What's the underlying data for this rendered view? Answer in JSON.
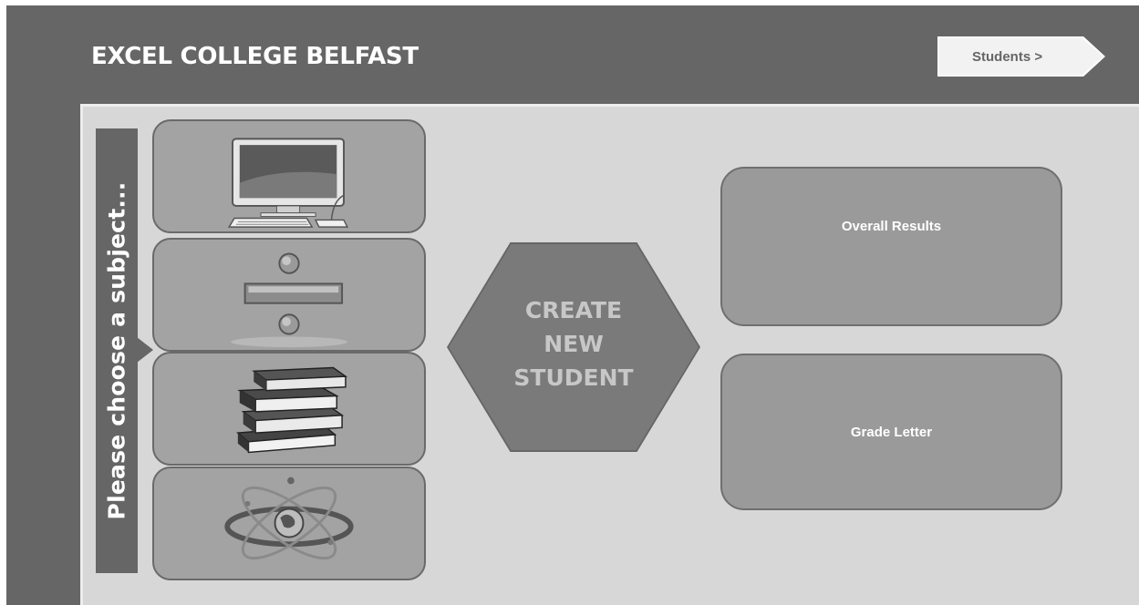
{
  "header": {
    "title": "EXCEL COLLEGE BELFAST",
    "students_button": "Students >"
  },
  "sidebar": {
    "label": "Please choose a subject...",
    "subjects": [
      {
        "icon": "computer-icon"
      },
      {
        "icon": "divide-icon"
      },
      {
        "icon": "books-icon"
      },
      {
        "icon": "atom-globe-icon"
      }
    ]
  },
  "main": {
    "create_lines": [
      "CREATE",
      "NEW",
      "STUDENT"
    ],
    "overall_results": "Overall Results",
    "grade_letter": "Grade Letter"
  },
  "colors": {
    "header_bg": "#666666",
    "panel_bg": "#d7d7d7",
    "tile_bg": "#a3a3a3",
    "button_bg": "#9a9a9a"
  }
}
